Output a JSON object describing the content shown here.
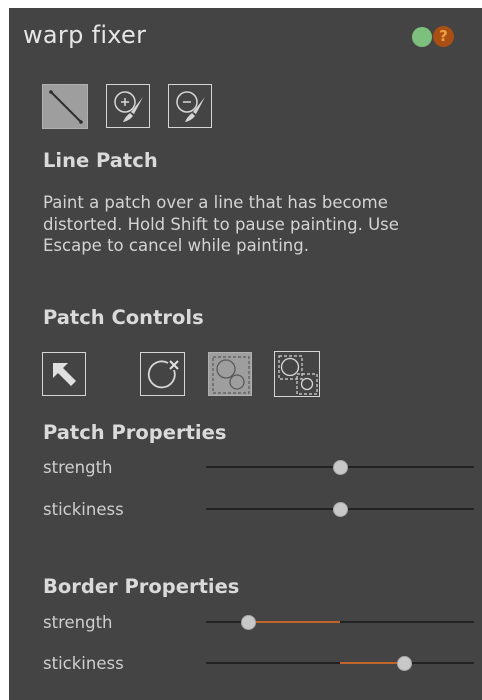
{
  "panel": {
    "title": "warp fixer",
    "status_color": "#7dc07d",
    "help_glyph": "?",
    "help_color": "#a94f14"
  },
  "tools": [
    {
      "name": "line-patch-tool",
      "icon": "diagonal-line-icon",
      "active": true
    },
    {
      "name": "add-paint-tool",
      "icon": "brush-plus-icon",
      "active": false
    },
    {
      "name": "remove-paint-tool",
      "icon": "brush-minus-icon",
      "active": false
    }
  ],
  "line_patch": {
    "heading": "Line Patch",
    "description": "Paint a patch over a line that has become distorted. Hold Shift to pause painting. Use Escape to cancel while painting."
  },
  "patch_controls": {
    "heading": "Patch Controls",
    "buttons": [
      {
        "name": "select-arrow-button",
        "icon": "arrow-up-left-icon",
        "active": false
      },
      {
        "name": "delete-patch-button",
        "icon": "circle-x-icon",
        "active": false
      },
      {
        "name": "patch-group-button",
        "icon": "circles-group-icon",
        "active": true
      },
      {
        "name": "patch-split-button",
        "icon": "circles-split-icon",
        "active": false
      }
    ]
  },
  "patch_properties": {
    "heading": "Patch Properties",
    "sliders": [
      {
        "label": "strength",
        "value": 0.5,
        "fill_from": null
      },
      {
        "label": "stickiness",
        "value": 0.5,
        "fill_from": null
      }
    ]
  },
  "border_properties": {
    "heading": "Border Properties",
    "sliders": [
      {
        "label": "strength",
        "value": 0.16,
        "fill_from": 0.5
      },
      {
        "label": "stickiness",
        "value": 0.74,
        "fill_from": 0.5
      }
    ]
  },
  "colors": {
    "panel_bg": "#444444",
    "accent_orange": "#c0662a",
    "track": "#222222"
  }
}
